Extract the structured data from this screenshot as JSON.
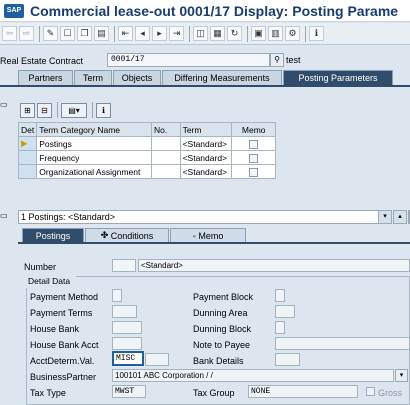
{
  "window": {
    "title": "Commercial lease-out 0001/17 Display: Posting Parame"
  },
  "record": {
    "label": "Real Estate Contract",
    "value": "0001/17",
    "description": "test"
  },
  "tabs": [
    "Partners",
    "Term",
    "Objects",
    "Differing Measurements",
    "Posting Parameters"
  ],
  "active_tab": "Posting Parameters",
  "table": {
    "headers": [
      "Det",
      "Term Category Name",
      "No.",
      "Term",
      "Memo"
    ],
    "rows": [
      {
        "name": "Postings",
        "no": "",
        "term": "<Standard>",
        "memo": false
      },
      {
        "name": "Frequency",
        "no": "",
        "term": "<Standard>",
        "memo": false
      },
      {
        "name": "Organizational Assignment",
        "no": "",
        "term": "<Standard>",
        "memo": false
      }
    ]
  },
  "selector": {
    "value": "1 Postings: <Standard>"
  },
  "subtabs": [
    "Postings",
    "Conditions",
    "Memo"
  ],
  "active_subtab": "Postings",
  "number": {
    "label": "Number",
    "value": "",
    "desc": "<Standard>"
  },
  "detail_data": {
    "title": "Detail Data",
    "left": [
      {
        "label": "Payment Method",
        "value": ""
      },
      {
        "label": "Payment Terms",
        "value": ""
      },
      {
        "label": "House Bank",
        "value": ""
      },
      {
        "label": "House Bank Acct",
        "value": ""
      },
      {
        "label": "AcctDeterm.Val.",
        "value": "MISC"
      }
    ],
    "right": [
      {
        "label": "Payment Block",
        "value": ""
      },
      {
        "label": "Dunning Area",
        "value": ""
      },
      {
        "label": "Dunning Block",
        "value": ""
      },
      {
        "label": "Note to Payee",
        "value": ""
      },
      {
        "label": "Bank Details",
        "value": ""
      }
    ],
    "business_partner": {
      "label": "BusinessPartner",
      "value": "100101 ABC Corporation / /"
    },
    "tax_type": {
      "label": "Tax Type",
      "value": "MWST"
    },
    "tax_group": {
      "label": "Tax Group",
      "value": "NONE"
    },
    "gross": {
      "label": "Gross"
    }
  },
  "colors": {
    "accent": "#2f4d6b",
    "title": "#1a3c6e"
  }
}
